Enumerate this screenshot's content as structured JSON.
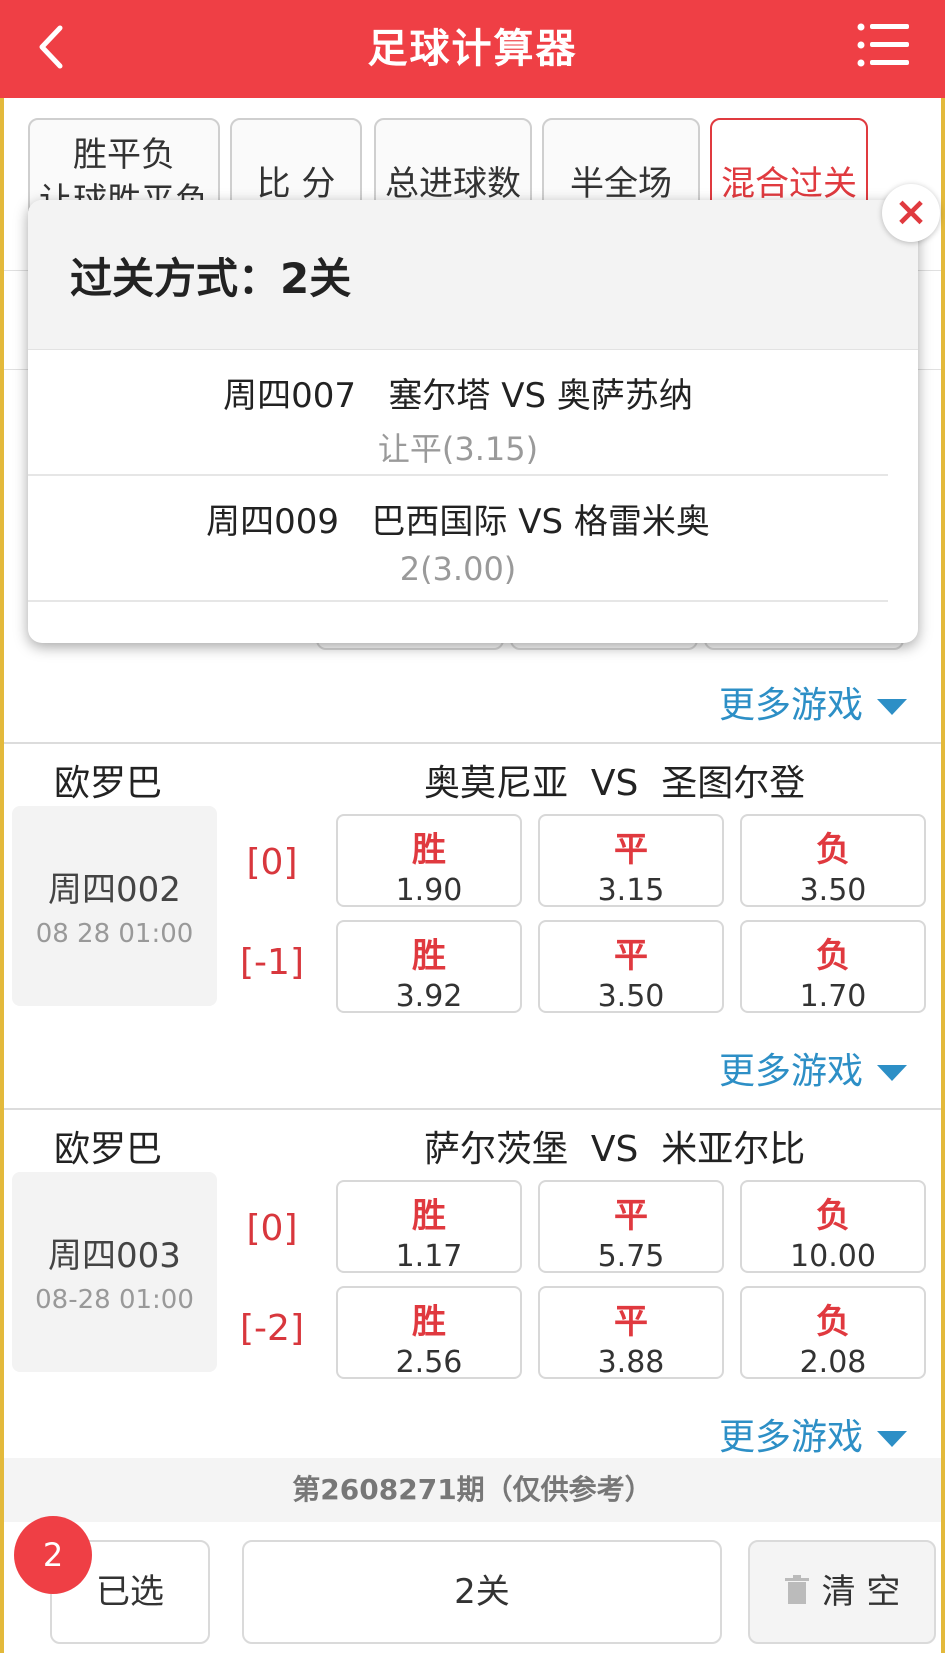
{
  "header": {
    "title": "足球计算器"
  },
  "tabs": [
    {
      "label": "胜平负\n让球胜平负"
    },
    {
      "label": "比 分"
    },
    {
      "label": "总进球数"
    },
    {
      "label": "半全场"
    },
    {
      "label": "混合过关"
    }
  ],
  "popup": {
    "title": "过关方式：2关",
    "items": [
      {
        "match": "周四007   塞尔塔 VS 奥萨苏纳",
        "pick": "让平(3.15)"
      },
      {
        "match": "周四009   巴西国际 VS 格雷米奥",
        "pick": "2(3.00)"
      }
    ]
  },
  "more_label": "更多游戏",
  "matches": [
    {
      "league": "欧罗巴",
      "teams": "奥莫尼亚  VS  圣图尔登",
      "no": "周四002",
      "time": "08 28 01:00",
      "rows": [
        {
          "hcap": "[0]",
          "odds": [
            {
              "label": "胜",
              "value": "1.90"
            },
            {
              "label": "平",
              "value": "3.15"
            },
            {
              "label": "负",
              "value": "3.50"
            }
          ]
        },
        {
          "hcap": "[-1]",
          "odds": [
            {
              "label": "胜",
              "value": "3.92"
            },
            {
              "label": "平",
              "value": "3.50"
            },
            {
              "label": "负",
              "value": "1.70"
            }
          ]
        }
      ]
    },
    {
      "league": "欧罗巴",
      "teams": "萨尔茨堡  VS  米亚尔比",
      "no": "周四003",
      "time": "08-28 01:00",
      "rows": [
        {
          "hcap": "[0]",
          "odds": [
            {
              "label": "胜",
              "value": "1.17"
            },
            {
              "label": "平",
              "value": "5.75"
            },
            {
              "label": "负",
              "value": "10.00"
            }
          ]
        },
        {
          "hcap": "[-2]",
          "odds": [
            {
              "label": "胜",
              "value": "2.56"
            },
            {
              "label": "平",
              "value": "3.88"
            },
            {
              "label": "负",
              "value": "2.08"
            }
          ]
        }
      ]
    }
  ],
  "period": "第2608271期（仅供参考）",
  "bottom": {
    "badge": "2",
    "selected_label": "已选",
    "mode_label": "2关",
    "clear_label": "清 空"
  },
  "colors": {
    "brand_red": "#ef3f45",
    "link_blue": "#2d8fc6",
    "frame_gold": "#e3b93b"
  }
}
